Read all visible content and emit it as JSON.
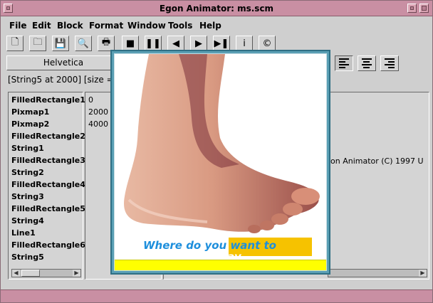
{
  "window": {
    "title": "Egon Animator: ms.scm"
  },
  "menu": [
    "File",
    "Edit",
    "Block",
    "Format",
    "Window",
    "Tools",
    "Help"
  ],
  "toolbar": {
    "icons": [
      "new-file-icon",
      "open-folder-icon",
      "save-icon",
      "preview-zoom-icon",
      "print-icon",
      "stop-icon",
      "pause-icon",
      "rewind-icon",
      "play-icon",
      "fast-forward-icon",
      "info-icon",
      "copyright-icon"
    ],
    "glyphs": [
      "🗋",
      "🗀",
      "💾",
      "🔍",
      "🖶",
      "■",
      "❚❚",
      "◀",
      "▶",
      "▶❚",
      "i",
      "©"
    ]
  },
  "format": {
    "font_label": "Helvetica"
  },
  "status": {
    "text": "[String5 at 2000] [size = 3"
  },
  "objects": {
    "names": [
      "FilledRectangle1",
      "Pixmap1",
      "Pixmap2",
      "FilledRectangle2",
      "String1",
      "FilledRectangle3",
      "String2",
      "FilledRectangle4",
      "String3",
      "FilledRectangle5",
      "String4",
      "Line1",
      "FilledRectangle6",
      "String5"
    ],
    "times": [
      "0",
      "2000",
      "4000"
    ]
  },
  "properties": {
    "visible_text": "on Animator (C) 1997 U"
  },
  "preview": {
    "slogan": "Where do you want to",
    "slogan_partial": "today"
  }
}
